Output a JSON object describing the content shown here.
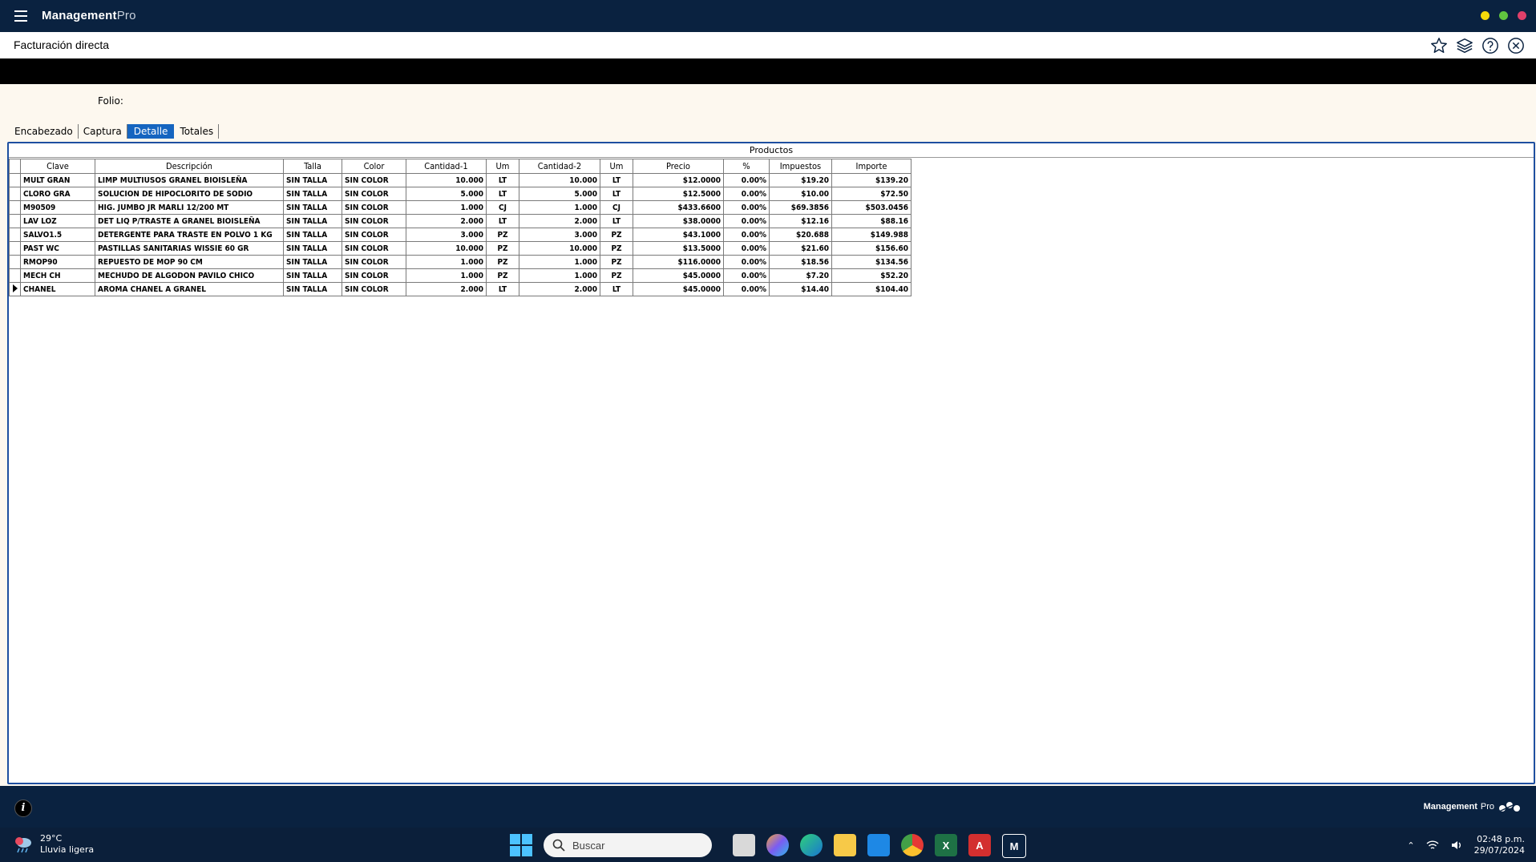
{
  "app": {
    "title_main": "Management",
    "title_suffix": "Pro",
    "window_dots": [
      "#f5d90a",
      "#60c43f",
      "#e0406a"
    ]
  },
  "page": {
    "title": "Facturación directa",
    "folio_label": "Folio:"
  },
  "tabs": [
    {
      "label": "Encabezado",
      "active": false
    },
    {
      "label": "Captura",
      "active": false
    },
    {
      "label": "Detalle",
      "active": true
    },
    {
      "label": "Totales",
      "active": false
    }
  ],
  "grid": {
    "caption": "Productos",
    "columns": [
      "Clave",
      "Descripción",
      "Talla",
      "Color",
      "Cantidad-1",
      "Um",
      "Cantidad-2",
      "Um",
      "Precio",
      "%",
      "Impuestos",
      "Importe"
    ],
    "rows": [
      [
        "MULT GRAN",
        "LIMP MULTIUSOS GRANEL BIOISLEÑA",
        "SIN TALLA",
        "SIN COLOR",
        "10.000",
        "LT",
        "10.000",
        "LT",
        "$12.0000",
        "0.00%",
        "$19.20",
        "$139.20"
      ],
      [
        "CLORO GRA",
        "SOLUCION DE HIPOCLORITO DE SODIO",
        "SIN TALLA",
        "SIN COLOR",
        "5.000",
        "LT",
        "5.000",
        "LT",
        "$12.5000",
        "0.00%",
        "$10.00",
        "$72.50"
      ],
      [
        "M90509",
        "HIG. JUMBO JR MARLI 12/200 MT",
        "SIN TALLA",
        "SIN COLOR",
        "1.000",
        "CJ",
        "1.000",
        "CJ",
        "$433.6600",
        "0.00%",
        "$69.3856",
        "$503.0456"
      ],
      [
        "LAV LOZ",
        "DET LIQ P/TRASTE A GRANEL BIOISLEÑA",
        "SIN TALLA",
        "SIN COLOR",
        "2.000",
        "LT",
        "2.000",
        "LT",
        "$38.0000",
        "0.00%",
        "$12.16",
        "$88.16"
      ],
      [
        "SALVO1.5",
        "DETERGENTE PARA TRASTE EN POLVO 1 KG",
        "SIN TALLA",
        "SIN COLOR",
        "3.000",
        "PZ",
        "3.000",
        "PZ",
        "$43.1000",
        "0.00%",
        "$20.688",
        "$149.988"
      ],
      [
        "PAST WC",
        "PASTILLAS SANITARIAS WISSIE 60 GR",
        "SIN TALLA",
        "SIN COLOR",
        "10.000",
        "PZ",
        "10.000",
        "PZ",
        "$13.5000",
        "0.00%",
        "$21.60",
        "$156.60"
      ],
      [
        "RMOP90",
        "REPUESTO DE MOP  90 CM",
        "SIN TALLA",
        "SIN COLOR",
        "1.000",
        "PZ",
        "1.000",
        "PZ",
        "$116.0000",
        "0.00%",
        "$18.56",
        "$134.56"
      ],
      [
        "MECH CH",
        "MECHUDO DE ALGODON PAVILO CHICO",
        "SIN TALLA",
        "SIN COLOR",
        "1.000",
        "PZ",
        "1.000",
        "PZ",
        "$45.0000",
        "0.00%",
        "$7.20",
        "$52.20"
      ],
      [
        "CHANEL",
        "AROMA CHANEL A GRANEL",
        "SIN TALLA",
        "SIN COLOR",
        "2.000",
        "LT",
        "2.000",
        "LT",
        "$45.0000",
        "0.00%",
        "$14.40",
        "$104.40"
      ]
    ],
    "selected_row": 8
  },
  "footer": {
    "brand_main": "Management",
    "brand_suffix": "Pro"
  },
  "taskbar": {
    "weather_temp": "29°C",
    "weather_text": "Lluvia ligera",
    "search_placeholder": "Buscar",
    "clock_time": "02:48 p.m.",
    "clock_date": "29/07/2024"
  }
}
